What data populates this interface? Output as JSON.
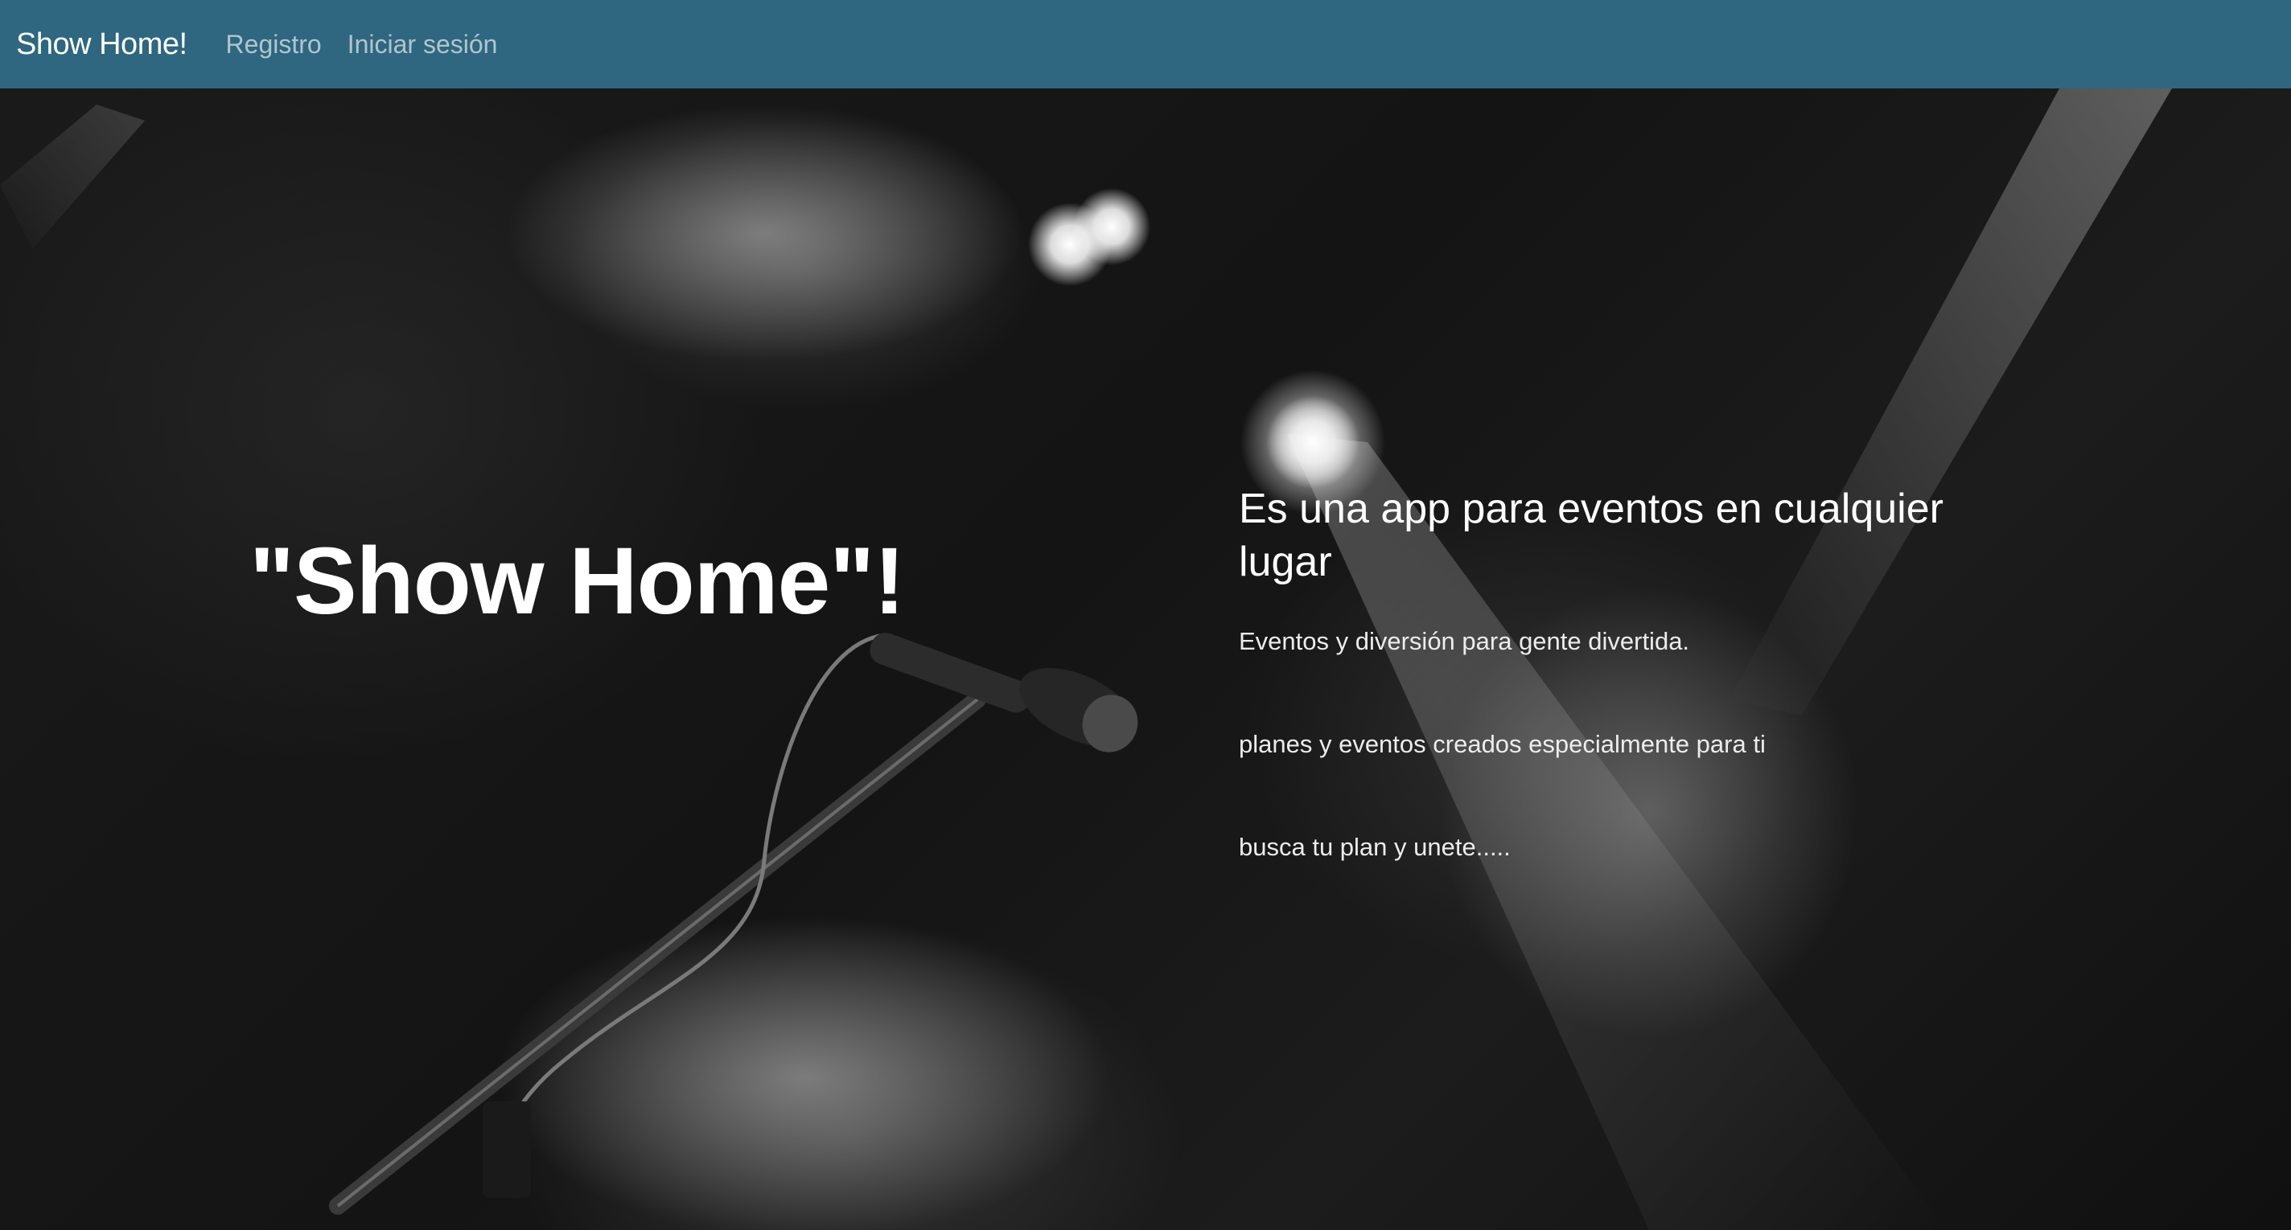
{
  "navbar": {
    "brand": "Show Home!",
    "links": [
      {
        "label": "Registro"
      },
      {
        "label": "Iniciar sesión"
      }
    ],
    "background_color": "#2e677f"
  },
  "hero": {
    "title": "\"Show Home\"!",
    "subtitle": "Es una app para eventos en cualquier lugar",
    "lines": [
      "Eventos y diversión para gente divertida.",
      "planes y eventos creados especialmente para ti",
      "busca tu plan y unete....."
    ],
    "background": "black-and-white concert stage with microphone"
  }
}
